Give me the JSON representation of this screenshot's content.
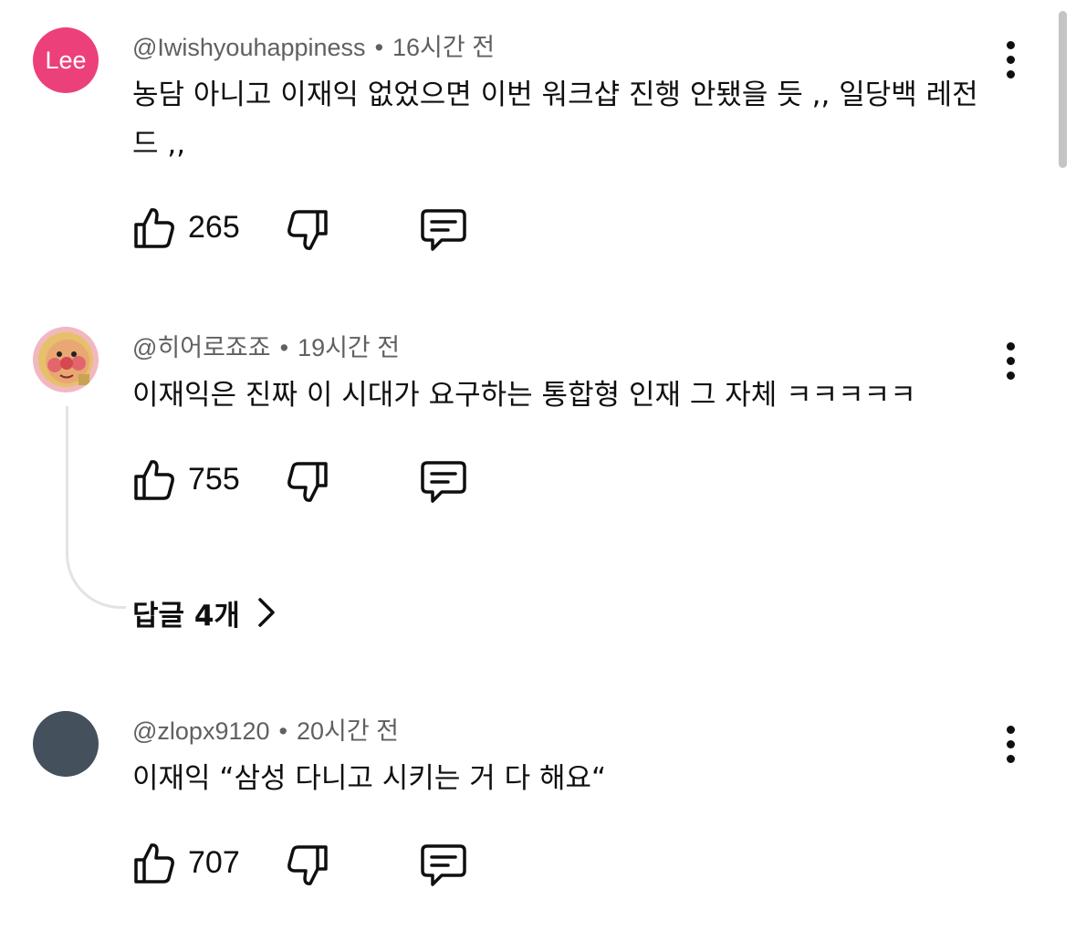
{
  "comments": [
    {
      "avatar_text": "Lee",
      "avatar_color": "#ec407a",
      "username": "@Iwishyouhappiness",
      "time": "16시간 전",
      "text": "농담 아니고 이재익 없었으면 이번 워크샵 진행 안됐을 듯 ,, 일당백 레전드 ,,",
      "likes": "265"
    },
    {
      "avatar_icon": "anpanman-avatar-icon",
      "username": "@히어로죠죠",
      "time": "19시간 전",
      "text": "이재익은 진짜 이 시대가 요구하는 통합형 인재 그 자체 ㅋㅋㅋㅋㅋ",
      "likes": "755",
      "replies_label": "답글 4개"
    },
    {
      "avatar_color": "#44505b",
      "username": "@zlopx9120",
      "time": "20시간 전",
      "text": "이재익 “삼성 다니고 시키는 거 다 해요“",
      "likes": "707"
    }
  ],
  "meta_separator": "•",
  "icons": {
    "like": "thumbs-up-icon",
    "dislike": "thumbs-down-icon",
    "reply": "comment-icon",
    "more": "more-vertical-icon",
    "expand": "chevron-right-icon"
  }
}
